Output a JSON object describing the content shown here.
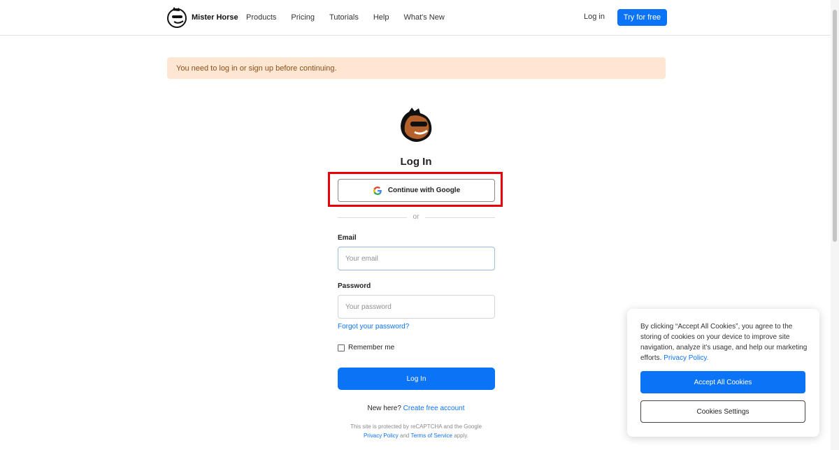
{
  "header": {
    "brand_name": "Mister Horse",
    "nav": [
      "Products",
      "Pricing",
      "Tutorials",
      "Help",
      "What's New"
    ],
    "login_label": "Log in",
    "try_label": "Try for free",
    "accent_color": "#0b73f5"
  },
  "alert": {
    "message": "You need to log in or sign up before continuing."
  },
  "login": {
    "title": "Log In",
    "google_label": "Continue with Google",
    "divider": "or",
    "email_label": "Email",
    "email_placeholder": "Your email",
    "password_label": "Password",
    "password_placeholder": "Your password",
    "forgot_label": "Forgot your password?",
    "remember_label": "Remember me",
    "submit_label": "Log In",
    "new_here": "New here?",
    "create_account": "Create free account",
    "recaptcha_text": "This site is protected by reCAPTCHA and the Google",
    "privacy_policy": "Privacy Policy",
    "and": "and",
    "terms": "Terms of Service",
    "apply": "apply."
  },
  "cookie": {
    "text": "By clicking “Accept All Cookies”, you agree to the storing of cookies on your device to improve site navigation, analyze it’s usage, and help our marketing efforts.",
    "privacy_link": "Privacy Policy.",
    "accept_label": "Accept All Cookies",
    "settings_label": "Cookies Settings"
  }
}
